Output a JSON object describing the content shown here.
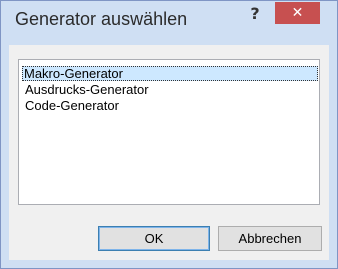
{
  "window": {
    "title": "Generator auswählen",
    "help_glyph": "?",
    "close_glyph": "✕"
  },
  "list": {
    "items": [
      {
        "label": "Makro-Generator",
        "selected": true
      },
      {
        "label": "Ausdrucks-Generator",
        "selected": false
      },
      {
        "label": "Code-Generator",
        "selected": false
      }
    ]
  },
  "buttons": {
    "ok_label": "OK",
    "cancel_label": "Abbrechen"
  },
  "colors": {
    "titlebar": "#cfdff3",
    "close_button": "#c75050",
    "selection": "#cde8ff"
  }
}
